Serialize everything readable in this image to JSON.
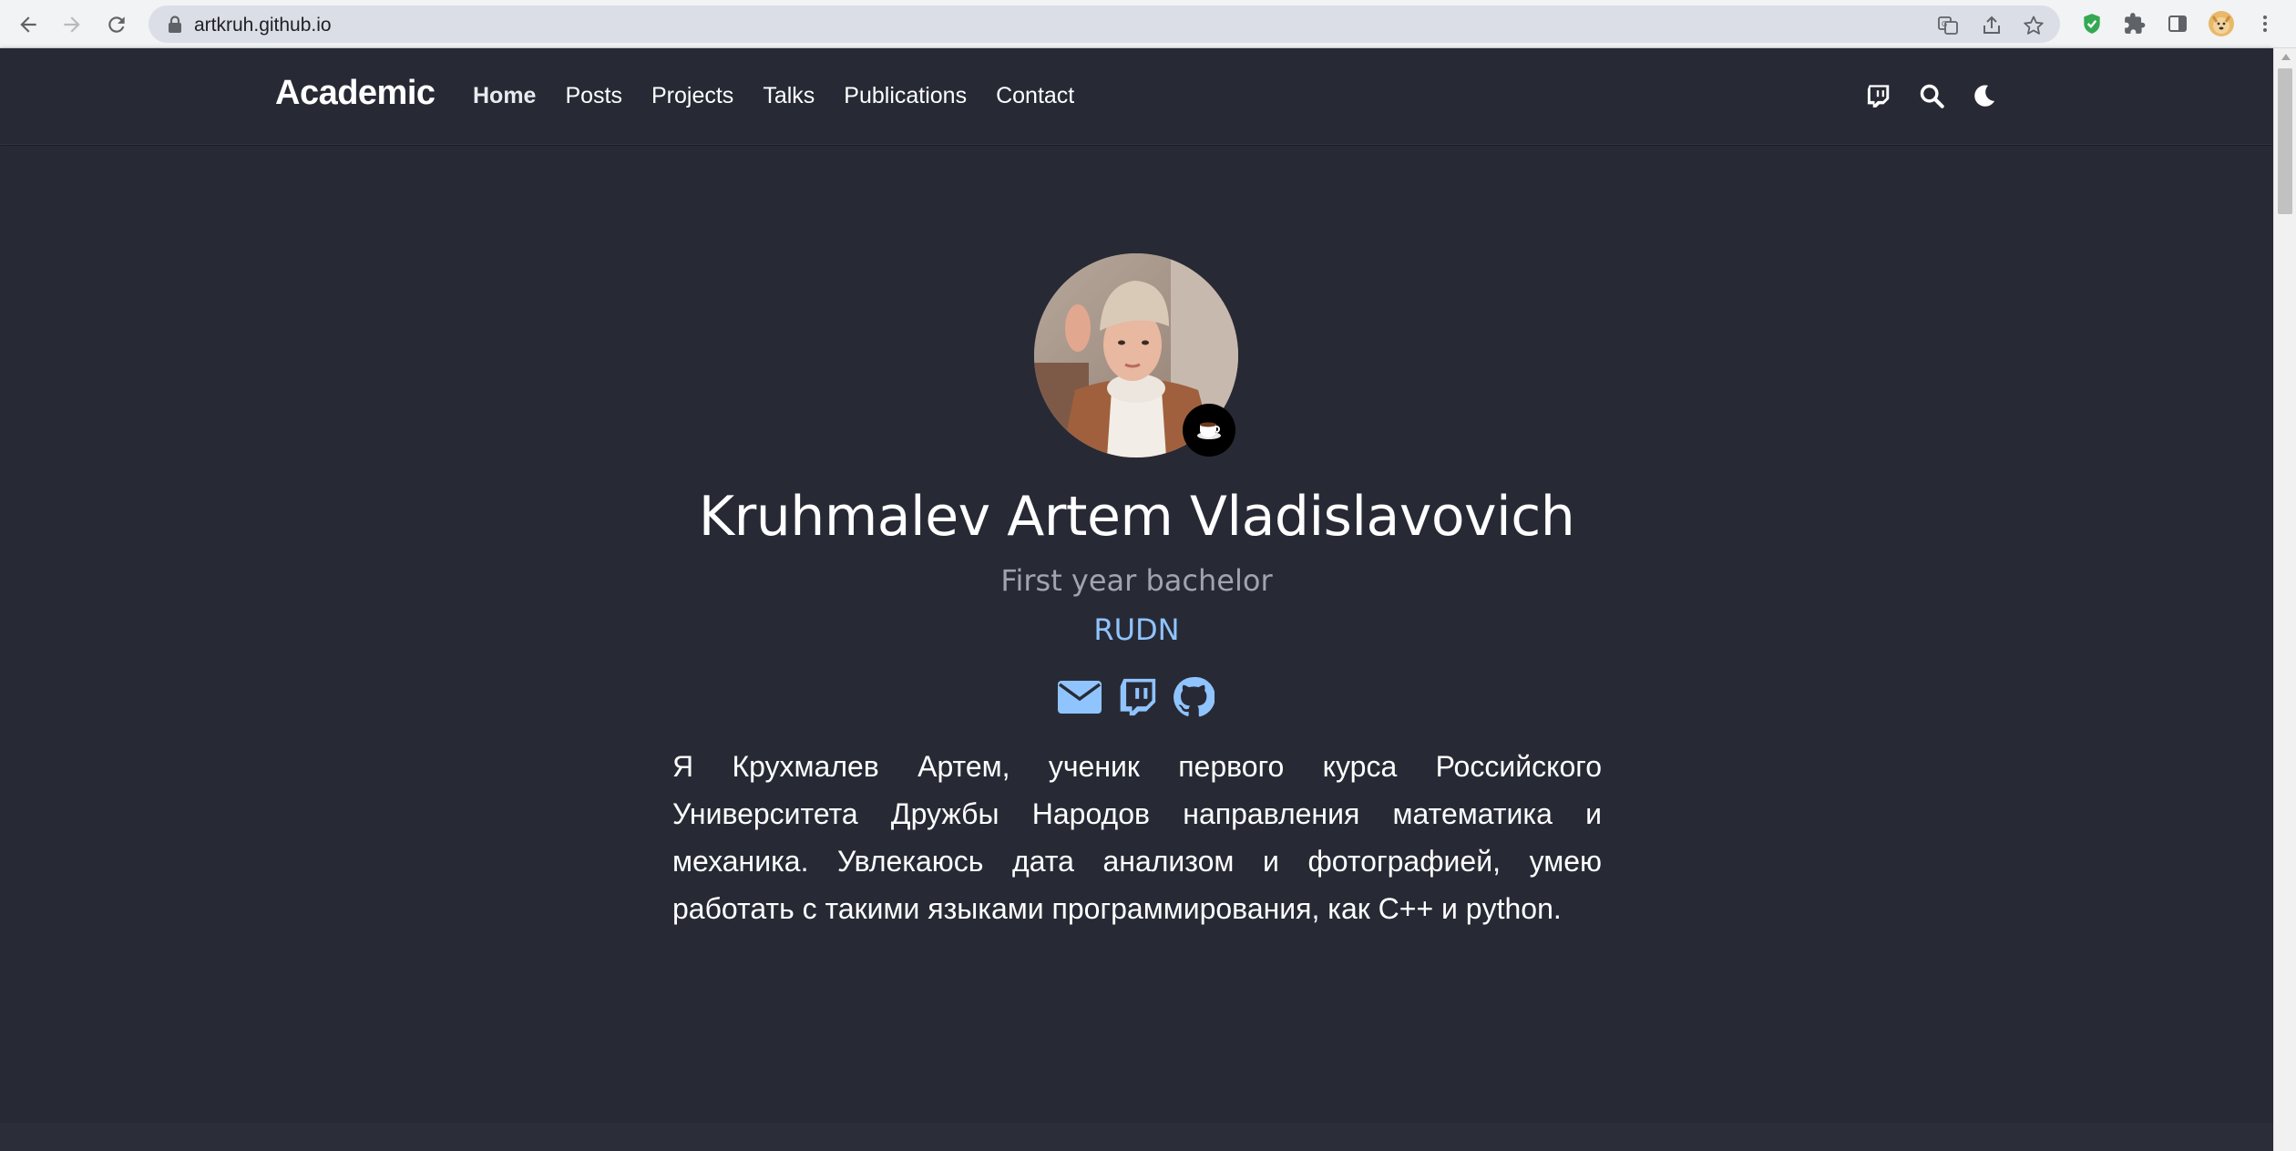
{
  "browser": {
    "url": "artkruh.github.io"
  },
  "site": {
    "brand": "Academic",
    "nav": [
      {
        "label": "Home",
        "active": true
      },
      {
        "label": "Posts"
      },
      {
        "label": "Projects"
      },
      {
        "label": "Talks"
      },
      {
        "label": "Publications"
      },
      {
        "label": "Contact"
      }
    ],
    "nav_icons": [
      "twitch-icon",
      "search-icon",
      "moon-icon"
    ]
  },
  "profile": {
    "name": "Kruhmalev Artem Vladislavovich",
    "role": "First year bachelor",
    "organization": "RUDN",
    "status_emoji": "coffee-icon",
    "social_icons": [
      "envelope-icon",
      "twitch-icon",
      "github-icon"
    ],
    "bio": "Я Крухмалев Артем, ученик первого курса Российского Университета Дружбы Народов направления математика и механика. Увлекаюсь дата анализом и фотографией, умею работать с такими языками программирования, как C++ и python."
  },
  "colors": {
    "background": "#272a35",
    "accent_link": "#90c4ff",
    "muted_text": "#a0a4ad"
  }
}
